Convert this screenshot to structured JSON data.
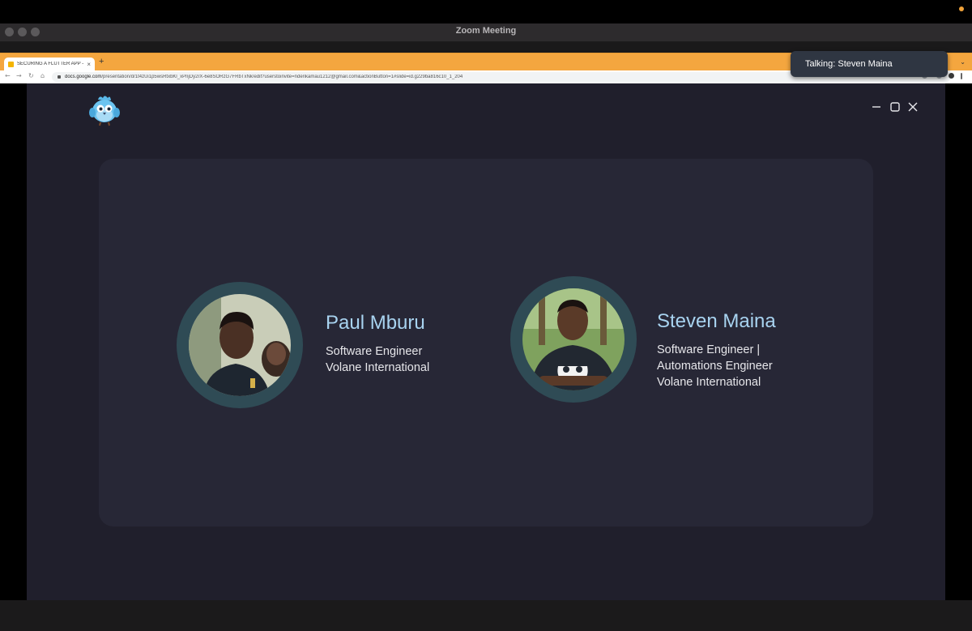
{
  "window": {
    "title": "Zoom Meeting"
  },
  "browser": {
    "tab_title": "SECURING A FLUTTER APP - ",
    "tab_close": "×",
    "new_tab": "+",
    "url_host": "docs.google.com",
    "url_path": "/presentation/d/1t4zUi1p5wsRtxbKl_xPnjDy2rX-6e8SORzG7FRbTxNk/edit?userstoinvite=nderikamau1212@gmail.com&actionButton=1#slide=id.g229ba816c10_1_204",
    "chevron": "⌄"
  },
  "notification": {
    "text": "Talking: Steven Maina"
  },
  "slide": {
    "people": [
      {
        "name": "Paul Mburu",
        "role_lines": [
          "Software Engineer",
          "Volane International"
        ]
      },
      {
        "name": "Steven Maina",
        "role_lines": [
          "Software Engineer |",
          "Automations Engineer",
          "Volane International"
        ]
      }
    ]
  },
  "icons": {
    "logo": "dash-bird-icon",
    "minimize": "minimize-icon",
    "maximize": "maximize-icon",
    "close": "close-icon"
  },
  "colors": {
    "chrome_frame": "#f4a63f",
    "slide_bg": "#201f2c",
    "card_bg": "#272736",
    "avatar_ring": "#2f4b55",
    "name_color": "#a8d3f0"
  }
}
